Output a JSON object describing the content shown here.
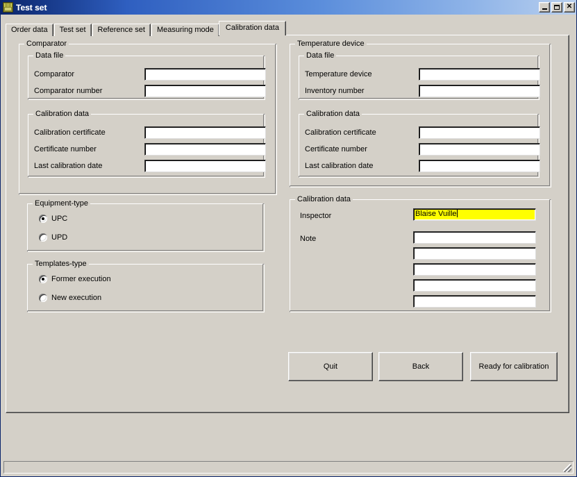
{
  "window": {
    "title": "Test set",
    "icon": "app-icon",
    "buttons": {
      "minimize": "_",
      "maximize": "□",
      "close": "✕"
    }
  },
  "tabs": [
    {
      "label": "Order data",
      "active": false
    },
    {
      "label": "Test set",
      "active": false
    },
    {
      "label": "Reference set",
      "active": false
    },
    {
      "label": "Measuring mode",
      "active": false
    },
    {
      "label": "Calibration data",
      "active": true
    }
  ],
  "comparator": {
    "caption": "Comparator",
    "data_file": {
      "caption": "Data file",
      "fields": [
        {
          "label": "Comparator",
          "value": ""
        },
        {
          "label": "Comparator number",
          "value": ""
        }
      ]
    },
    "calibration_data": {
      "caption": "Calibration data",
      "fields": [
        {
          "label": "Calibration certificate",
          "value": ""
        },
        {
          "label": "Certificate number",
          "value": ""
        },
        {
          "label": "Last calibration date",
          "value": ""
        }
      ]
    }
  },
  "equipment_type": {
    "caption": "Equipment-type",
    "options": [
      {
        "label": "UPC",
        "checked": true
      },
      {
        "label": "UPD",
        "checked": false
      }
    ]
  },
  "templates_type": {
    "caption": "Templates-type",
    "options": [
      {
        "label": "Former execution",
        "checked": true
      },
      {
        "label": "New execution",
        "checked": false
      }
    ]
  },
  "temperature_device": {
    "caption": "Temperature device",
    "data_file": {
      "caption": "Data file",
      "fields": [
        {
          "label": "Temperature device",
          "value": ""
        },
        {
          "label": "Inventory number",
          "value": ""
        }
      ]
    },
    "calibration_data": {
      "caption": "Calibration data",
      "fields": [
        {
          "label": "Calibration certificate",
          "value": ""
        },
        {
          "label": "Certificate number",
          "value": ""
        },
        {
          "label": "Last calibration date",
          "value": ""
        }
      ]
    }
  },
  "calibration_data": {
    "caption": "Calibration data",
    "inspector": {
      "label": "Inspector",
      "value": "Blaise Vuille",
      "focused": true,
      "highlight_color": "#ffff00"
    },
    "note": {
      "label": "Note",
      "values": [
        "",
        "",
        "",
        "",
        ""
      ]
    }
  },
  "actions": [
    {
      "label": "Quit"
    },
    {
      "label": "Back"
    },
    {
      "label": "Ready for calibration"
    }
  ],
  "statusbar": {
    "text": ""
  }
}
